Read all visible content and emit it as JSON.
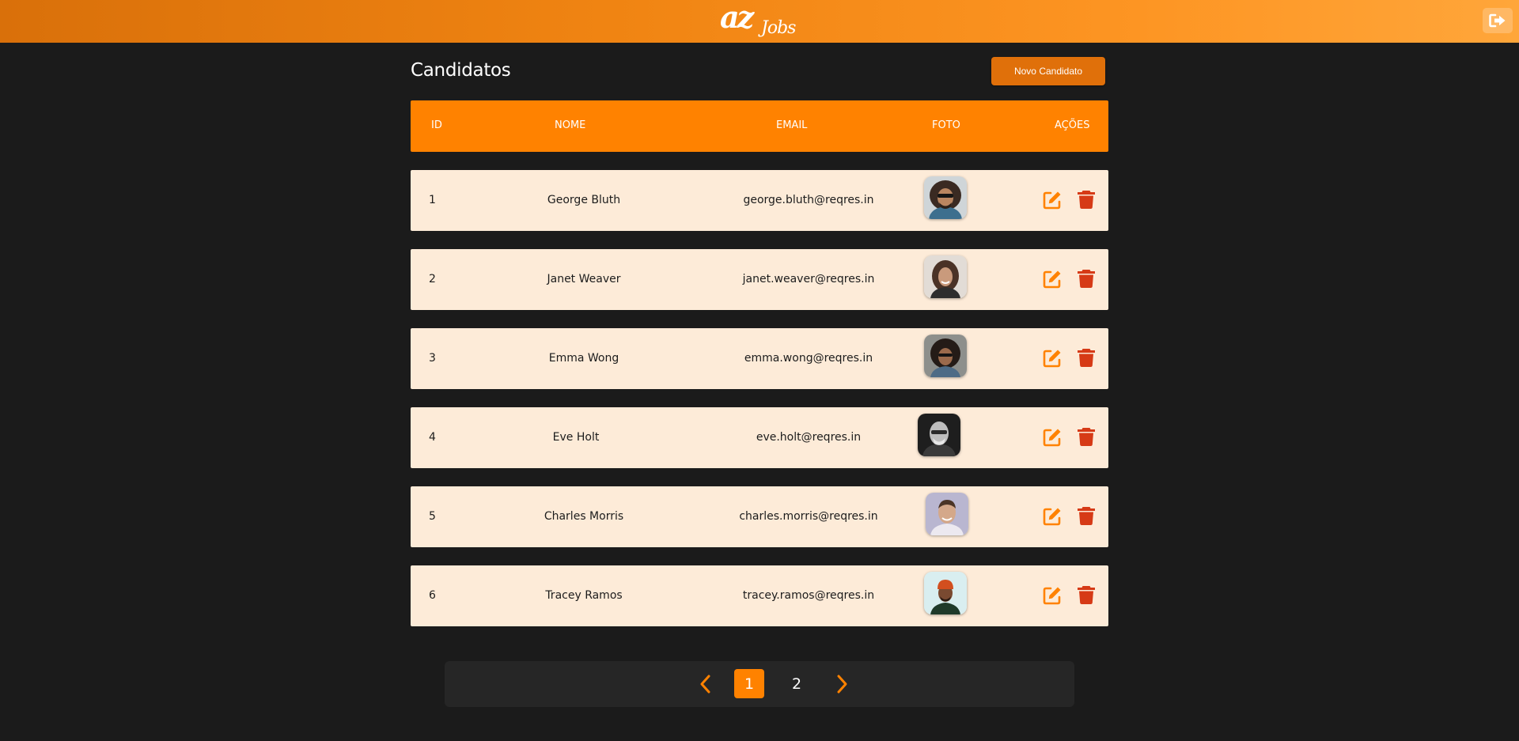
{
  "header": {
    "logo_icon": "azjobs-logo-icon",
    "logout_icon": "sign-out-icon",
    "accent_color": "#ff8200"
  },
  "page": {
    "title": "Candidatos",
    "new_button_label": "Novo Candidato"
  },
  "table": {
    "columns": [
      "ID",
      "NOME",
      "EMAIL",
      "FOTO",
      "AÇÕES"
    ],
    "rows": [
      {
        "id": "1",
        "name": "George Bluth",
        "email": "george.bluth@reqres.in"
      },
      {
        "id": "2",
        "name": "Janet Weaver",
        "email": "janet.weaver@reqres.in"
      },
      {
        "id": "3",
        "name": "Emma Wong",
        "email": "emma.wong@reqres.in"
      },
      {
        "id": "4",
        "name": "Eve Holt",
        "email": "eve.holt@reqres.in"
      },
      {
        "id": "5",
        "name": "Charles Morris",
        "email": "charles.morris@reqres.in"
      },
      {
        "id": "6",
        "name": "Tracey Ramos",
        "email": "tracey.ramos@reqres.in"
      }
    ],
    "edit_icon": "edit-icon",
    "delete_icon": "trash-icon",
    "edit_color": "#ff8200",
    "delete_color": "#d63a16"
  },
  "pagination": {
    "pages": [
      "1",
      "2"
    ],
    "active_page": "1",
    "prev_icon": "chevron-left-icon",
    "next_icon": "chevron-right-icon"
  }
}
